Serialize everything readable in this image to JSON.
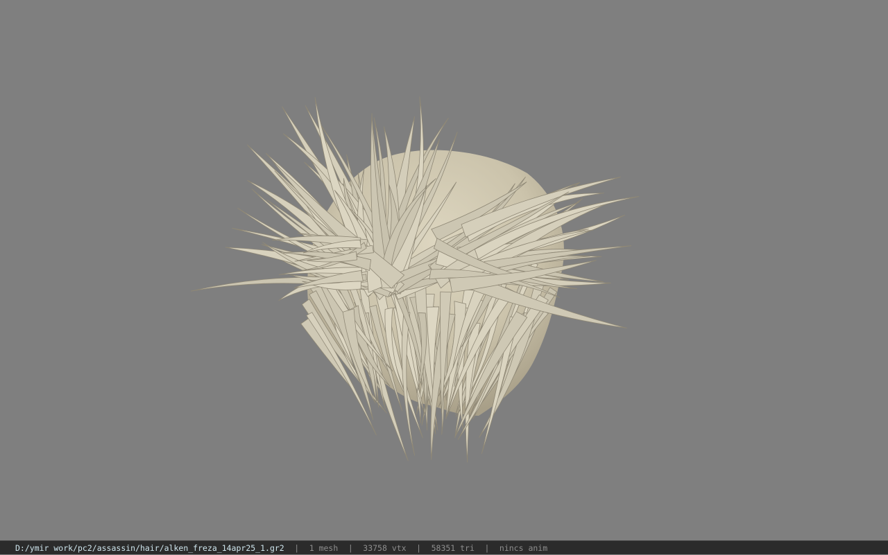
{
  "viewport": {
    "background": "#7f7f7f",
    "model": {
      "icon": "hair-mesh",
      "color": "#d2cbb5",
      "shadow_color": "#a8a08a"
    }
  },
  "status_bar": {
    "path": "D:/ymir work/pc2/assassin/hair/alken_freza_14apr25_1.gr2",
    "separator": "|",
    "mesh": "1 mesh",
    "vertices": "33758 vtx",
    "triangles": "58351 tri",
    "anim": "nincs anim",
    "path_color": "#cfe6ee",
    "text_color": "#8e8e8e",
    "background": "#2b2b2b"
  }
}
